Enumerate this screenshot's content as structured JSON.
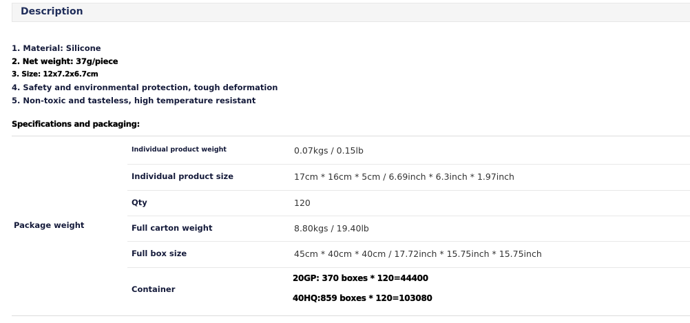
{
  "header": {
    "title": "Description"
  },
  "specs": [
    "1. Material: Silicone",
    "2. Net weight: 37g/piece",
    "3. Size: 12x7.2x6.7cm",
    "4. Safety and environmental protection, tough deformation",
    "5. Non-toxic and tasteless, high temperature resistant"
  ],
  "packaging": {
    "title": "Specifications and packaging:",
    "group_label": "Package weight",
    "rows": [
      {
        "label": "Individual product weight",
        "value": "0.07kgs / 0.15lb"
      },
      {
        "label": "Individual product size",
        "value": "17cm * 16cm * 5cm / 6.69inch * 6.3inch * 1.97inch"
      },
      {
        "label": "Qty",
        "value": "120"
      },
      {
        "label": "Full carton weight",
        "value": "8.80kgs / 19.40lb"
      },
      {
        "label": "Full box size",
        "value": "45cm * 40cm * 40cm / 17.72inch * 15.75inch * 15.75inch"
      },
      {
        "label": "Container",
        "values": [
          "20GP: 370 boxes * 120=44400",
          "40HQ:859 boxes * 120=103080"
        ]
      }
    ]
  }
}
